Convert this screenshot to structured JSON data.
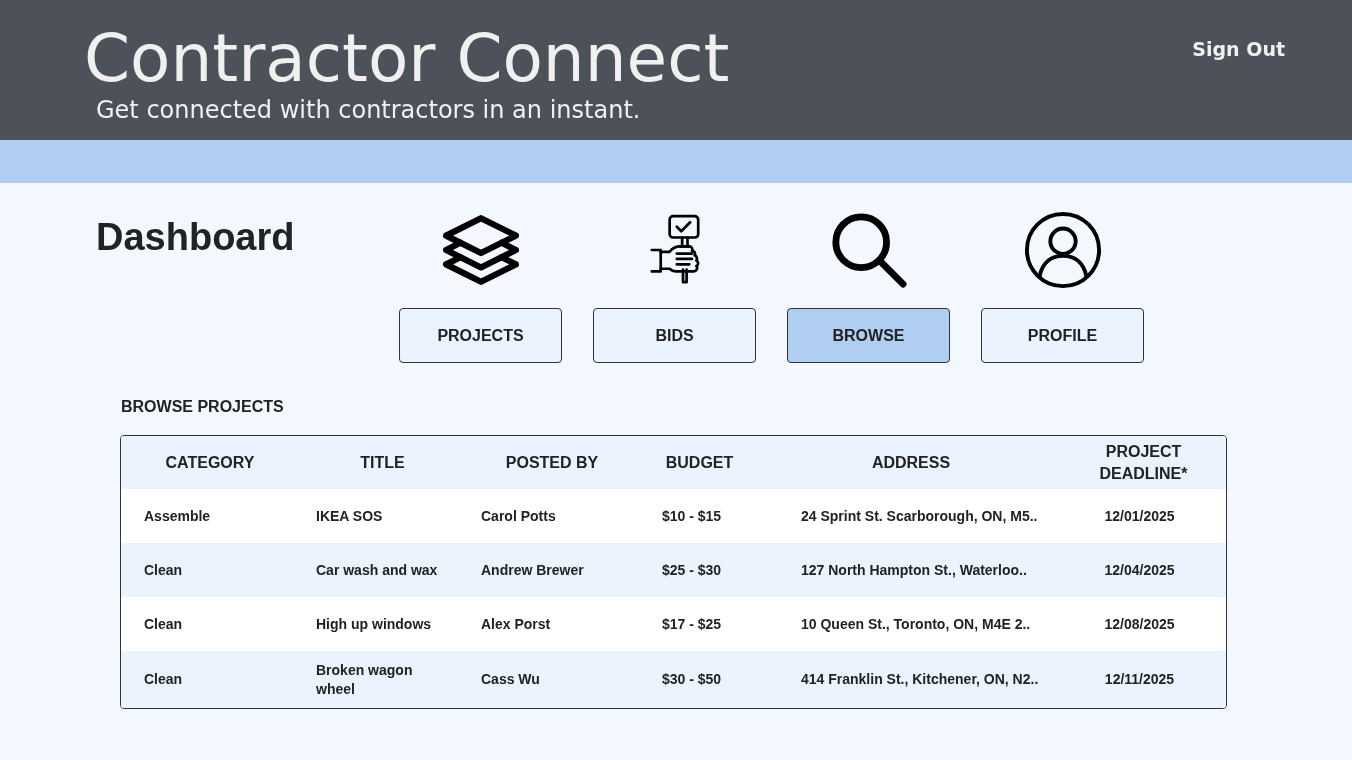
{
  "header": {
    "title": "Contractor Connect",
    "tagline": "Get connected with contractors in an instant.",
    "sign_out": "Sign Out"
  },
  "page_title": "Dashboard",
  "nav": [
    {
      "kind": "projects",
      "label": "PROJECTS",
      "selected": false
    },
    {
      "kind": "bids",
      "label": "BIDS",
      "selected": false
    },
    {
      "kind": "browse",
      "label": "BROWSE",
      "selected": true
    },
    {
      "kind": "profile",
      "label": "PROFILE",
      "selected": false
    }
  ],
  "section_title": "BROWSE PROJECTS",
  "table": {
    "columns": [
      "CATEGORY",
      "TITLE",
      "POSTED BY",
      "BUDGET",
      "ADDRESS",
      "PROJECT DEADLINE*"
    ],
    "rows": [
      [
        "Assemble",
        "IKEA SOS",
        "Carol Potts",
        "$10 - $15",
        "24 Sprint St. Scarborough, ON, M5..",
        "12/01/2025"
      ],
      [
        "Clean",
        "Car wash and wax",
        "Andrew Brewer",
        "$25 - $30",
        "127 North Hampton St., Waterloo..",
        "12/04/2025"
      ],
      [
        "Clean",
        "High up windows",
        "Alex Porst",
        "$17 - $25",
        "10 Queen St., Toronto, ON, M4E 2..",
        "12/08/2025"
      ],
      [
        "Clean",
        "Broken wagon wheel",
        "Cass Wu",
        "$30 - $50",
        "414 Franklin St., Kitchener, ON, N2..",
        "12/11/2025"
      ]
    ]
  }
}
